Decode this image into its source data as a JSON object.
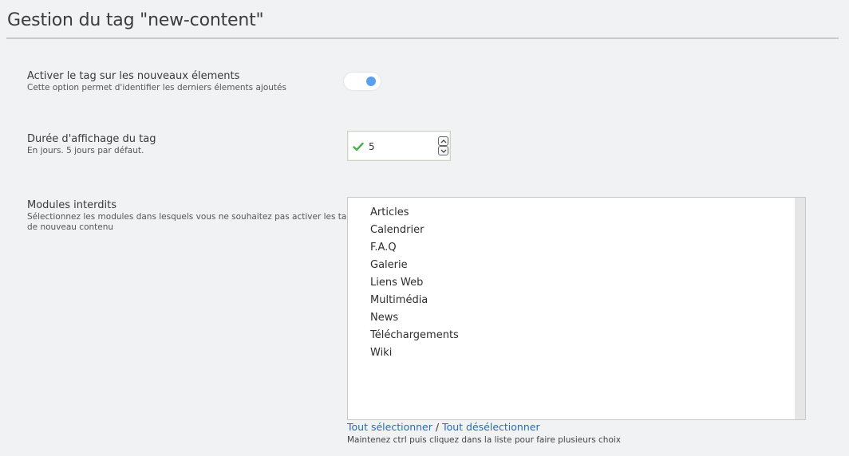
{
  "page": {
    "title": "Gestion du tag \"new-content\""
  },
  "fields": {
    "activate": {
      "label": "Activer le tag sur les nouveaux élements",
      "description": "Cette option permet d'identifier les derniers élements ajoutés",
      "enabled": true
    },
    "duration": {
      "label": "Durée d'affichage du tag",
      "description": "En jours. 5 jours par défaut.",
      "value": "5"
    },
    "forbidden_modules": {
      "label": "Modules interdits",
      "description_line1": "Sélectionnez les modules dans lesquels vous ne souhaitez pas activer les tags",
      "description_line2": "de nouveau contenu",
      "options": [
        "Articles",
        "Calendrier",
        "F.A.Q",
        "Galerie",
        "Liens Web",
        "Multimédia",
        "News",
        "Téléchargements",
        "Wiki"
      ],
      "select_all": "Tout sélectionner",
      "separator": " / ",
      "deselect_all": "Tout désélectionner",
      "hint": "Maintenez ctrl puis cliquez dans la liste pour faire plusieurs choix"
    }
  },
  "colors": {
    "accent": "#5a9ff0",
    "link": "#2a6bb5",
    "valid": "#4caf50"
  },
  "icons": {
    "check": "check-icon",
    "up": "chevron-up-icon",
    "down": "chevron-down-icon"
  }
}
